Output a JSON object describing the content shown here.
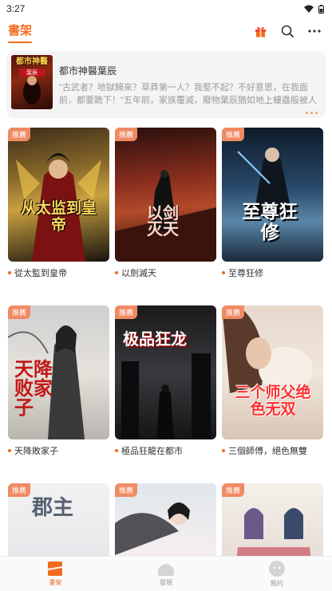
{
  "status_bar": {
    "time": "3:27"
  },
  "header": {
    "tab_label": "書架"
  },
  "recent": {
    "cover_title": "都市神醫",
    "cover_sub": "葉辰",
    "title": "都市神醫葉辰",
    "description": "\"古武者？地獄歸來？草莽第一人？我惹不起？不好意思，在我面前，都要跪下！\"五年前，家族覆滅，廢物葉辰猶如地上螻蟲般被人恥笑！但是五"
  },
  "books": [
    {
      "tag": "推薦",
      "title": "從太監到皇帝",
      "cover_text": "从太监到皇帝"
    },
    {
      "tag": "推薦",
      "title": "以劍滅天",
      "cover_text": "以剑灭天"
    },
    {
      "tag": "推薦",
      "title": "至尊狂修",
      "cover_text": "至尊狂修"
    },
    {
      "tag": "推薦",
      "title": "天降敗家子",
      "cover_text": "天降败家子"
    },
    {
      "tag": "推薦",
      "title": "極品狂龍在都市",
      "cover_text": "极品狂龙"
    },
    {
      "tag": "推薦",
      "title": "三個師傅，絕色無雙",
      "cover_text": "三个师父绝色无双"
    },
    {
      "tag": "推薦",
      "title": "",
      "cover_text": "郡主"
    },
    {
      "tag": "推薦",
      "title": "",
      "cover_text": ""
    },
    {
      "tag": "推薦",
      "title": "",
      "cover_text": ""
    }
  ],
  "bottom_nav": [
    {
      "label": "書架",
      "icon": "bookshelf-icon",
      "active": true
    },
    {
      "label": "發現",
      "icon": "discover-icon",
      "active": false
    },
    {
      "label": "我的",
      "icon": "profile-icon",
      "active": false
    }
  ],
  "colors": {
    "accent": "#f26b1d",
    "tag": "#f08a63"
  }
}
